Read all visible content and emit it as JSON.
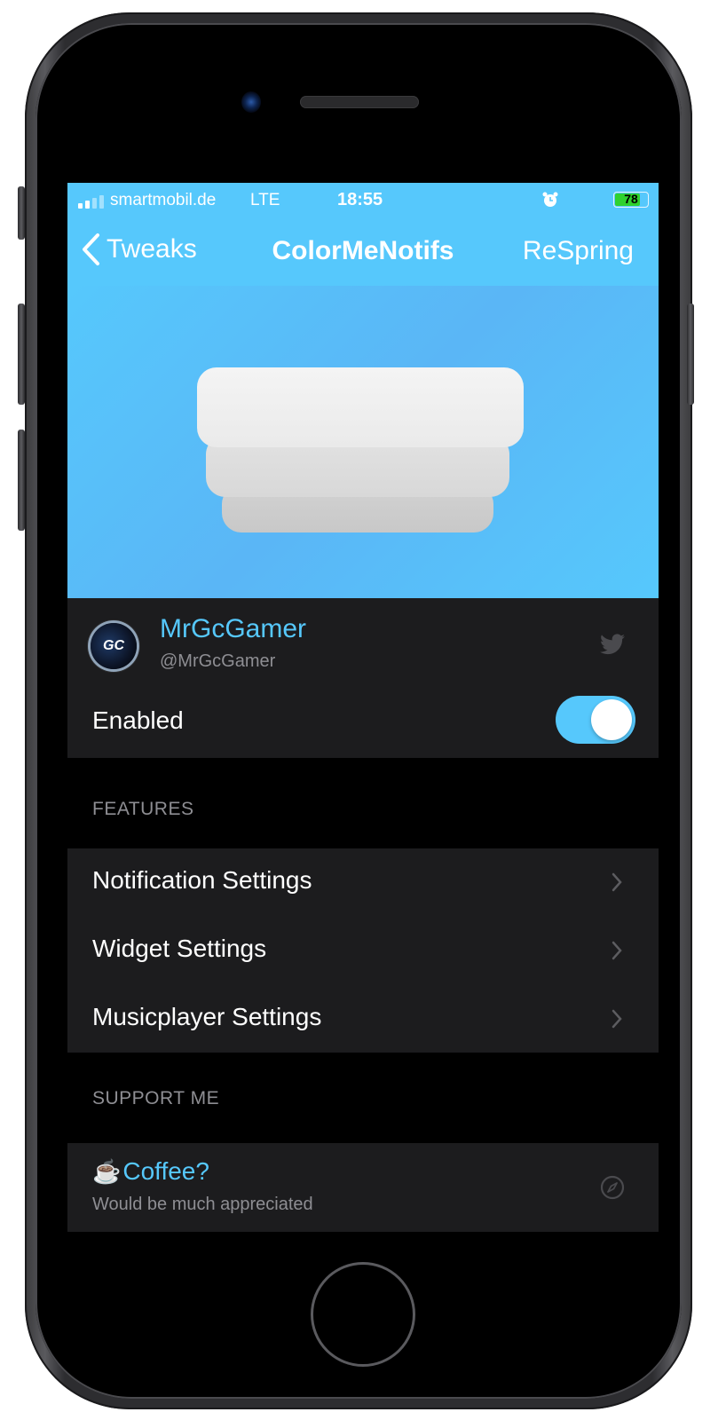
{
  "status_bar": {
    "carrier": "smartmobil.de",
    "network": "LTE",
    "time": "18:55",
    "battery_percent": 78,
    "battery_label": "78",
    "icons": [
      "signal-icon",
      "alarm-icon",
      "battery-icon"
    ]
  },
  "nav": {
    "back_label": "Tweaks",
    "title": "ColorMeNotifs",
    "action_label": "ReSpring"
  },
  "profile": {
    "avatar_initials": "GC",
    "name": "MrGcGamer",
    "handle": "@MrGcGamer",
    "social_icon": "twitter-icon"
  },
  "enabled_row": {
    "label": "Enabled",
    "value": true
  },
  "features": {
    "header": "FEATURES",
    "items": [
      {
        "label": "Notification Settings"
      },
      {
        "label": "Widget Settings"
      },
      {
        "label": "Musicplayer Settings"
      }
    ]
  },
  "support": {
    "header": "SUPPORT ME",
    "item": {
      "emoji": "☕",
      "title": "Coffee?",
      "subtitle": "Would be much appreciated",
      "icon": "compass-icon"
    }
  },
  "colors": {
    "accent": "#56c8fc",
    "card_bg": "#1c1c1e",
    "screen_bg": "#000000",
    "secondary_text": "#8e8e93",
    "battery_fill": "#2fd12f"
  }
}
